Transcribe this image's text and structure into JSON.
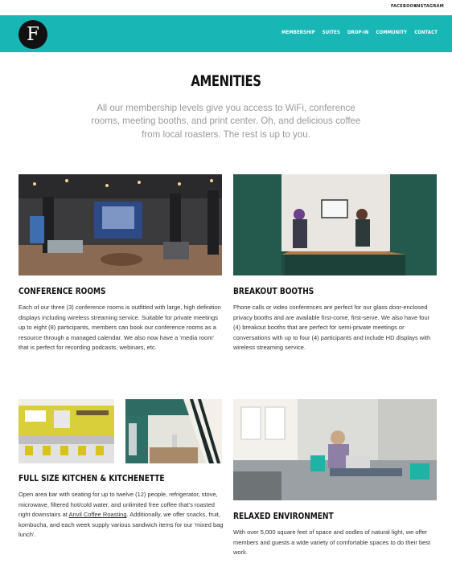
{
  "social": {
    "facebook": "FACEBOOK",
    "instagram": "INSTAGRAM"
  },
  "logo": {
    "letter": "F"
  },
  "nav": [
    "MEMBERSHIP",
    "SUITES",
    "DROP-IN",
    "COMMUNITY",
    "CONTACT"
  ],
  "colors": {
    "header": "#18b7b6",
    "logo_bg": "#111111",
    "intro_text": "#9a9a9a"
  },
  "page": {
    "title": "AMENITIES",
    "intro": "All our membership levels give you access to WiFi, conference rooms, meeting booths, and print center. Oh, and delicious coffee from local roasters. The rest is up to you."
  },
  "sections": {
    "conference": {
      "title": "CONFERENCE ROOMS",
      "body": "Each of our three (3) conference rooms is outfitted with large, high definition displays including wireless streaming service. Suitable for private meetings up to eight (8) participants, members can book our conference rooms as a resource through a managed calendar. We also now have a 'media room' that is perfect for recording podcasts, webinars, etc."
    },
    "breakout": {
      "title": "BREAKOUT BOOTHS",
      "body": "Phone calls or video conferences are perfect for our glass door-enclosed privacy booths and are available first-come, first-serve. We also have four (4) breakout booths that are perfect for semi-private meetings or conversations with up to four (4) participants and include HD displays with wireless streaming service."
    },
    "kitchen": {
      "title": "FULL SIZE KITCHEN & KITCHENETTE",
      "body_before": "Open area bar with seating for up to twelve (12) people, refrigerator, stove, microwave, filtered hot/cold water, and unlimited free coffee that's roasted right downstairs at ",
      "link": "Anvil Coffee Roasting",
      "body_after": ". Additionally, we offer snacks, fruit, kombucha, and each week supply various sandwich items for our 'mixed bag lunch'."
    },
    "relaxed": {
      "title": "RELAXED ENVIRONMENT",
      "body": "With over 5,000 square feet of space and oodles of natural light, we offer members and guests a wide variety of comfortable spaces to do their best work."
    }
  }
}
